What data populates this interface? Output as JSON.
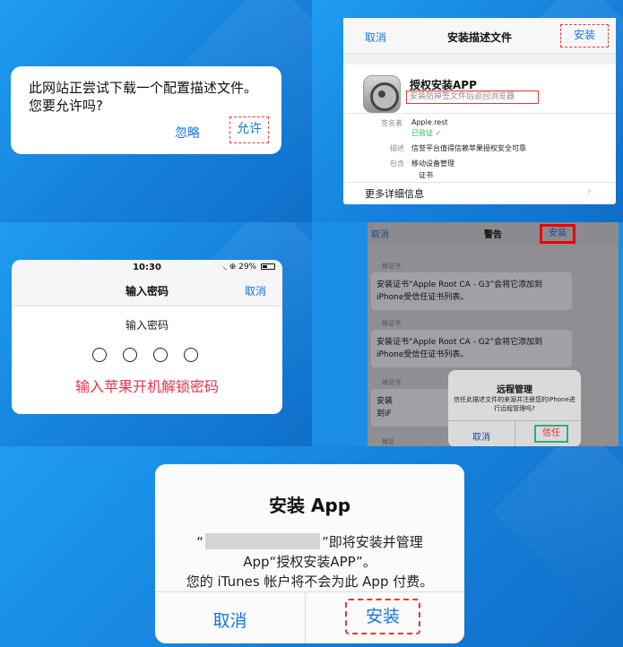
{
  "panel1": {
    "message_line1": "此网站正尝试下载一个配置描述文件。",
    "message_line2": "您要允许吗?",
    "ignore_label": "忽略",
    "allow_label": "允许"
  },
  "panel2": {
    "cancel_label": "取消",
    "title": "安装描述文件",
    "install_label": "安装",
    "app_name": "授权安装APP",
    "subtitle": "安装防掉签文件后返回浏览器",
    "signer_key": "签名者",
    "signer_value": "Apple.rest",
    "verified": "已验证 ✓",
    "desc_key": "描述",
    "desc_value": "信誉平台值得信赖苹果授权安全可靠",
    "contains_key": "包含",
    "contains_value1": "移动设备管理",
    "contains_value2": "证书",
    "more_info": "更多详细信息",
    "chevron": "›"
  },
  "panel3": {
    "time": "10:30",
    "status": "◟ ⊕ 29%",
    "title": "输入密码",
    "cancel_label": "取消",
    "prompt": "输入密码",
    "hint": "输入苹果开机解锁密码"
  },
  "panel4": {
    "cancel_label": "取消",
    "title": "警告",
    "install_label": "安装",
    "section_label1": "根证书",
    "cert_text1": "安装证书“Apple Root CA - G3”会将它添加到iPhone受信任证书列表。",
    "section_label2": "根证书",
    "cert_text2": "安装证书“Apple Root CA - G2”会将它添加到iPhone受信任证书列表。",
    "section_label3": "根证书",
    "partial_left_1": "安装",
    "partial_left_2": "到iF",
    "partial_right": "II",
    "section_label4": "根证",
    "dialog_title": "远程管理",
    "dialog_msg": "信任此描述文件的来源并注册您的iPhone进行远程管理吗?",
    "dialog_cancel": "取消",
    "dialog_trust": "信任"
  },
  "panel5": {
    "title": "安装 App",
    "line1_open": "“",
    "line1_rest": "”即将安装并管理",
    "line2": "App“授权安装APP”。",
    "line3": "您的 iTunes 帐户将不会为此 App 付费。",
    "cancel_label": "取消",
    "install_label": "安装"
  }
}
